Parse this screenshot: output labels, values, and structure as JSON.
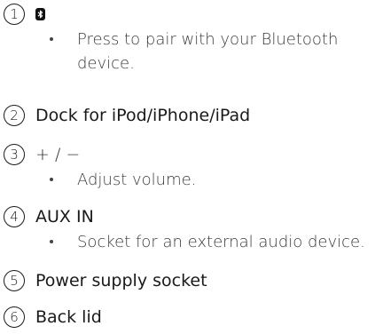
{
  "items": [
    {
      "number": "1",
      "title": "",
      "icon": "bluetooth-icon",
      "bullets": [
        "Press to pair with your Bluetooth device."
      ]
    },
    {
      "number": "2",
      "title": "Dock for iPod/iPhone/iPad",
      "bullets": []
    },
    {
      "number": "3",
      "title": "+ / −",
      "bullets": [
        "Adjust volume."
      ]
    },
    {
      "number": "4",
      "title": "AUX IN",
      "bullets": [
        "Socket for an external audio device."
      ]
    },
    {
      "number": "5",
      "title": "Power supply socket",
      "bullets": []
    },
    {
      "number": "6",
      "title": "Back lid",
      "bullets": []
    }
  ]
}
